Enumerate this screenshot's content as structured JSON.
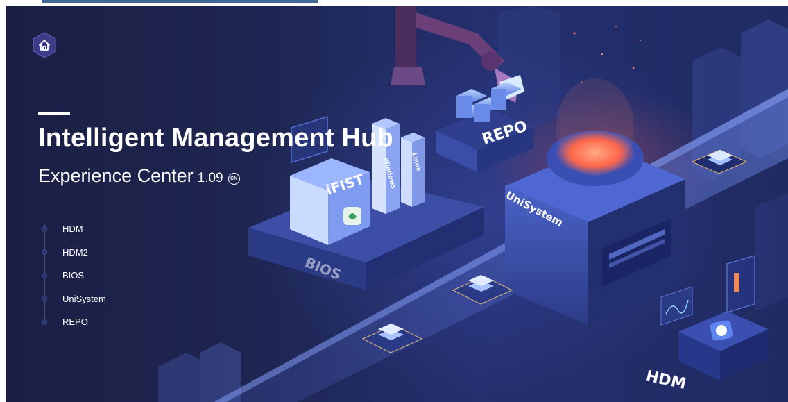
{
  "hero": {
    "title": "Intelligent Management Hub",
    "subtitle": "Experience Center",
    "version": "1.09",
    "lang_badge": "CN"
  },
  "nav": {
    "items": [
      {
        "label": "HDM"
      },
      {
        "label": "HDM2"
      },
      {
        "label": "BIOS"
      },
      {
        "label": "UniSystem"
      },
      {
        "label": "REPO"
      }
    ]
  },
  "illustration": {
    "labels": {
      "ifist": "iFIST",
      "windows": "Windows",
      "linux": "Linux",
      "repo": "REPO",
      "unisystem": "UniSystem",
      "bios": "BIOS",
      "hdm": "HDM"
    }
  },
  "icons": {
    "home": "home-icon",
    "lang": "cn-badge-icon"
  },
  "colors": {
    "background": "#1e2550",
    "accent_glow": "#ff6a50",
    "top_bar": "#3e6a93"
  }
}
